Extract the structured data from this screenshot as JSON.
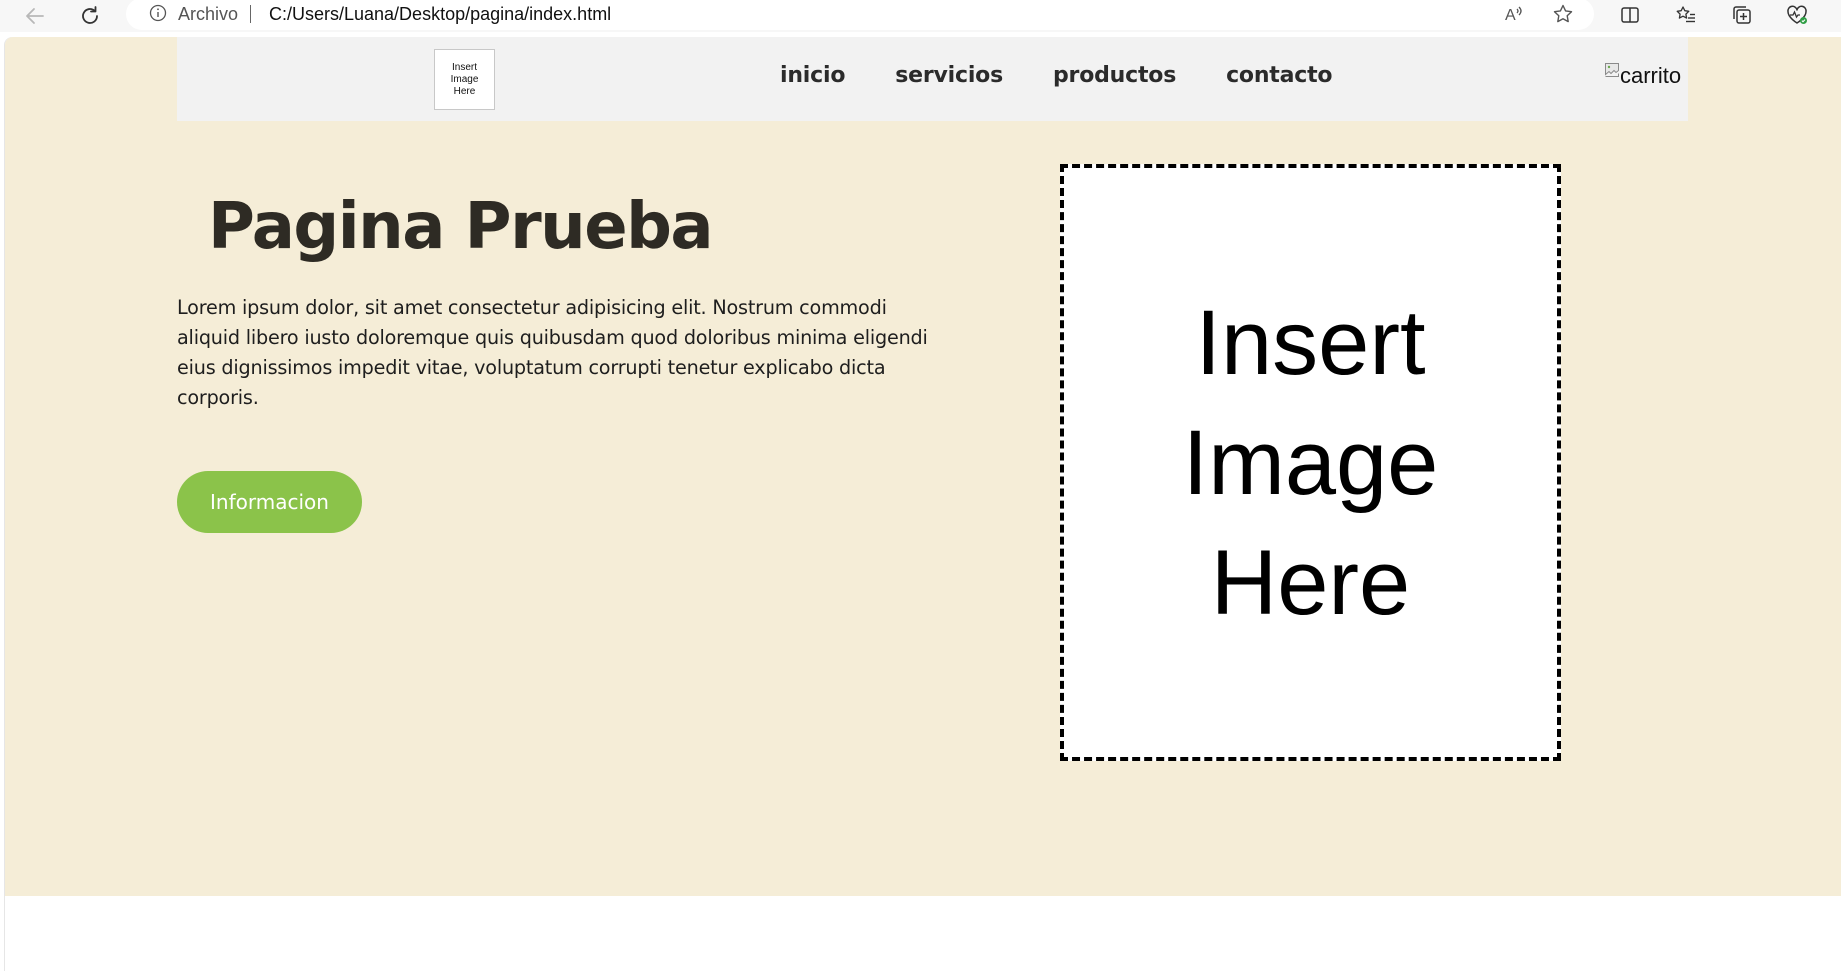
{
  "browser": {
    "address": {
      "scheme_label": "Archivo",
      "url": "C:/Users/Luana/Desktop/pagina/index.html"
    },
    "icons": {
      "back": "back-arrow-icon",
      "refresh": "refresh-icon",
      "info": "info-icon",
      "read_aloud": "read-aloud-icon",
      "favorite": "star-icon",
      "split_screen": "split-screen-icon",
      "favorites": "favorites-list-icon",
      "collections": "collections-icon",
      "performance": "heart-pulse-icon"
    }
  },
  "site": {
    "logo": {
      "placeholder_text": "Insert\nImage\nHere"
    },
    "nav": [
      {
        "label": "inicio"
      },
      {
        "label": "servicios"
      },
      {
        "label": "productos"
      },
      {
        "label": "contacto"
      }
    ],
    "cart": {
      "alt_text": "carrito"
    },
    "hero": {
      "title": "Pagina Prueba",
      "text": "Lorem ipsum dolor, sit amet consectetur adipisicing elit. Nostrum commodi aliquid libero iusto doloremque quis quibusdam quod doloribus minima eligendi eius dignissimos impedit vitae, voluptatum corrupti tenetur explicabo dicta corporis.",
      "button_label": "Informacion",
      "image_placeholder": "Insert\nImage\nHere"
    }
  },
  "colors": {
    "hero_background": "#f5edd7",
    "header_background": "#f2f2f2",
    "button_background": "#8bc34a",
    "title_color": "#2e2b24"
  }
}
